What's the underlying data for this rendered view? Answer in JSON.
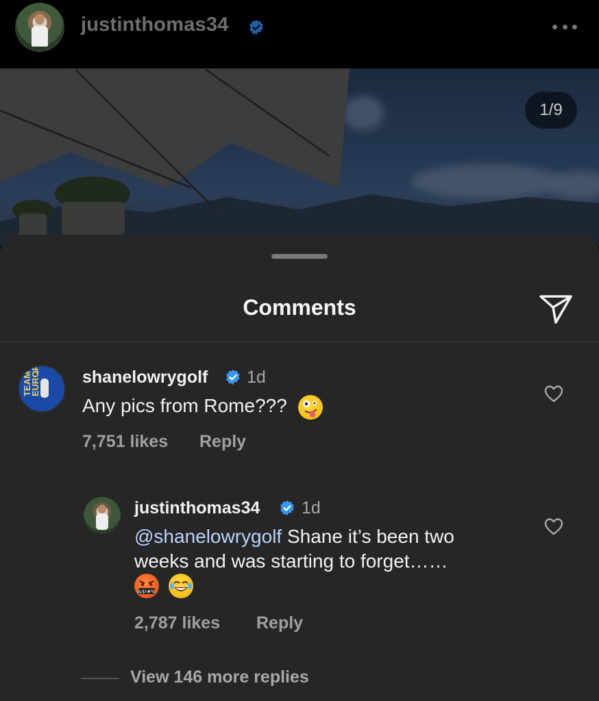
{
  "header": {
    "username": "justinthomas34",
    "verified_icon": "verified-badge-icon",
    "more_icon": "more-horizontal-icon"
  },
  "photo": {
    "counter": "1/9"
  },
  "sheet": {
    "title": "Comments",
    "share_icon": "send-paper-plane-icon"
  },
  "comments": [
    {
      "username": "shanelowrygolf",
      "age": "1d",
      "text": "Any pics from Rome???",
      "emoji": [
        "zany-face-emoji"
      ],
      "likes": "7,751 likes",
      "reply_label": "Reply"
    },
    {
      "username": "justinthomas34",
      "age": "1d",
      "mention": "@shanelowrygolf",
      "text_line1": " Shane it’s been two",
      "text_line2": "weeks and was starting to forget……",
      "emoji": [
        "face-with-symbols-on-mouth-emoji",
        "tears-of-joy-emoji"
      ],
      "likes": "2,787 likes",
      "reply_label": "Reply",
      "symbols_text": "&$!#%"
    }
  ],
  "view_more_replies": "View 146 more replies",
  "colors": {
    "sheet_bg": "#262626",
    "verified": "#3897f0",
    "mention": "#bcd3ff"
  }
}
